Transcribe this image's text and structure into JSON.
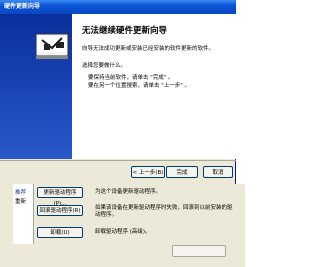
{
  "wizard": {
    "title": "硬件更新向导",
    "heading": "无法继续硬件更新向导",
    "text1": "向导无法成功更新或安装已经安装的软件更新的软件。",
    "text2": "选择您要做什么。",
    "text3": "要保持当前软件，请单击 \"完成\" 。",
    "text4": "要在另一个位置搜索，请单击 \"上一步\" 。",
    "buttons": {
      "back": "< 上一步(B)",
      "finish": "完成",
      "cancel": "取消"
    }
  },
  "props": {
    "tabs": [
      "推荐",
      "重新"
    ],
    "buttons": [
      "更新驱动程序(P)...",
      "回滚驱动程序(R)",
      "卸载(U)"
    ],
    "descriptions": [
      "为这个设备更新驱动程序。",
      "如果该设备在更新驱动程序时失败，回滚到以前安装的驱动程序。",
      "卸载驱动程序 (高级)。"
    ]
  }
}
